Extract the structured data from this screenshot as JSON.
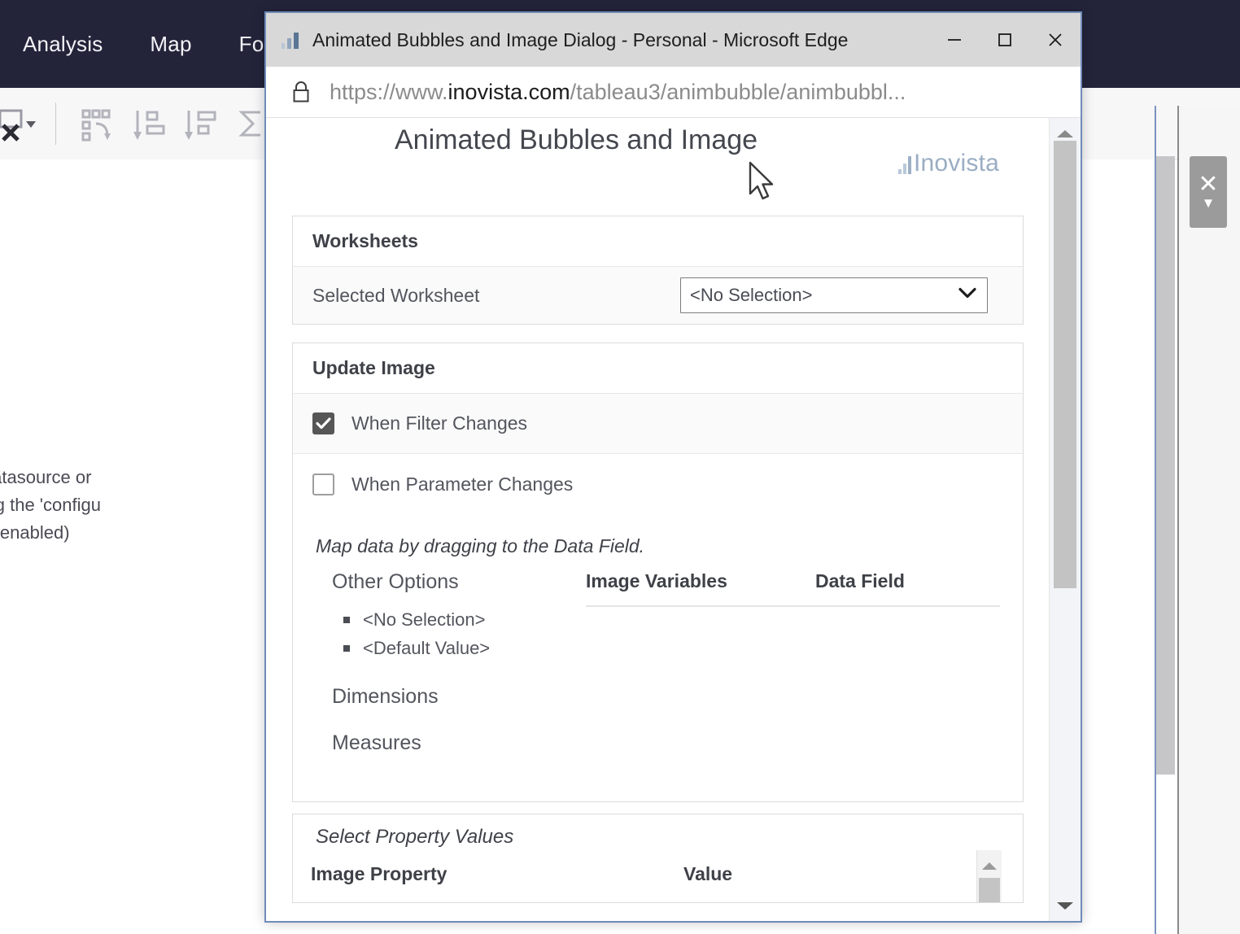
{
  "background_app": {
    "menu_items": [
      "Analysis",
      "Map",
      "Form"
    ],
    "toolbar_icons": [
      "clear-sheet-icon",
      "dropdown-caret-icon",
      "swap-rows-columns-icon",
      "sort-ascending-icon",
      "sort-descending-icon",
      "totals-sigma-icon",
      "totals-caret-icon"
    ],
    "message_lines": [
      "e either needs a datasource or",
      "set this by selecting the 'configu",
      "must have popups enabled)"
    ],
    "right_panel": {
      "close_label": "✕",
      "caret_label": "▼"
    }
  },
  "edge_window": {
    "favicon": "bar-chart-favicon",
    "title": "Animated Bubbles and Image Dialog - Personal - Microsoft Edge",
    "controls": {
      "minimize": "minimize-icon",
      "maximize": "maximize-icon",
      "close": "close-icon"
    },
    "address_bar": {
      "lock": "lock-icon",
      "url_scheme": "https://www.",
      "url_host": "inovista.com",
      "url_path": "/tableau3/animbubble/animbubbl..."
    }
  },
  "page": {
    "title": "Animated Bubbles and Image",
    "brand": "Inovista",
    "worksheets_panel": {
      "header": "Worksheets",
      "row_label": "Selected Worksheet",
      "selected_value": "<No Selection>",
      "caret": "chevron-down-icon"
    },
    "update_image_panel": {
      "header": "Update Image",
      "checkboxes": [
        {
          "label": "When Filter Changes",
          "checked": true
        },
        {
          "label": "When Parameter Changes",
          "checked": false
        }
      ],
      "hint": "Map data by dragging to the Data Field.",
      "other_options_header": "Other Options",
      "other_options": [
        "<No Selection>",
        "<Default Value>"
      ],
      "dimensions_header": "Dimensions",
      "measures_header": "Measures",
      "mapping_columns": [
        "Image Variables",
        "Data Field"
      ]
    },
    "property_panel": {
      "title": "Select Property Values",
      "columns": [
        "Image Property",
        "Value"
      ]
    }
  }
}
